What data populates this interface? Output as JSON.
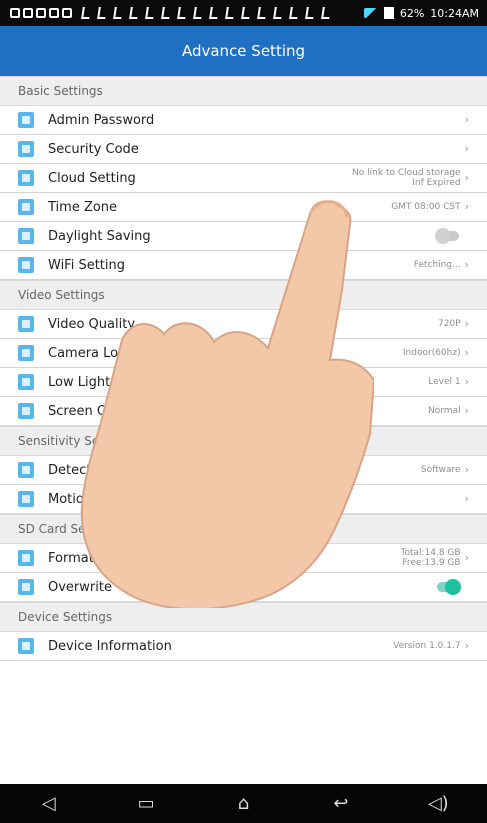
{
  "status": {
    "battery": "62%",
    "time": "10:24AM"
  },
  "header": {
    "title": "Advance Setting"
  },
  "sections": {
    "basic": {
      "title": "Basic Settings",
      "items": [
        {
          "label": "Admin Password",
          "value": ""
        },
        {
          "label": "Security Code",
          "value": ""
        },
        {
          "label": "Cloud Setting",
          "value_line1": "No link to Cloud storage",
          "value_line2": "Inf Expired"
        },
        {
          "label": "Time Zone",
          "value": "GMT 08:00 CST"
        },
        {
          "label": "Daylight Saving",
          "toggle": "off"
        },
        {
          "label": "WiFi Setting",
          "value": "Fetching..."
        }
      ]
    },
    "video": {
      "title": "Video Settings",
      "items": [
        {
          "label": "Video Quality",
          "value": "720P"
        },
        {
          "label": "Camera Location",
          "value": "Indoor(60hz)"
        },
        {
          "label": "Low Light Enhancement",
          "value": "Level 1"
        },
        {
          "label": "Screen Orientation",
          "value": "Normal"
        }
      ]
    },
    "sensitivity": {
      "title": "Sensitivity Settings",
      "items": [
        {
          "label": "Detect Mode",
          "value": "Software"
        },
        {
          "label": "Motion Mask",
          "value": ""
        }
      ]
    },
    "sd": {
      "title": "SD Card Settings",
      "items": [
        {
          "label": "Format SD Card",
          "value_line1": "Total:14.8 GB",
          "value_line2": "Free:13.9 GB"
        },
        {
          "label": "Overwrite",
          "toggle": "on"
        }
      ]
    },
    "device": {
      "title": "Device Settings",
      "items": [
        {
          "label": "Device Information",
          "value": "Version 1.0.1.7"
        }
      ]
    }
  },
  "icons": {
    "row_icon": "settings-item-icon",
    "chevron": "chevron-right-icon"
  },
  "colors": {
    "titlebar": "#1f6fc2",
    "accent": "#59b6ea",
    "toggle_on": "#1fbf9f"
  }
}
